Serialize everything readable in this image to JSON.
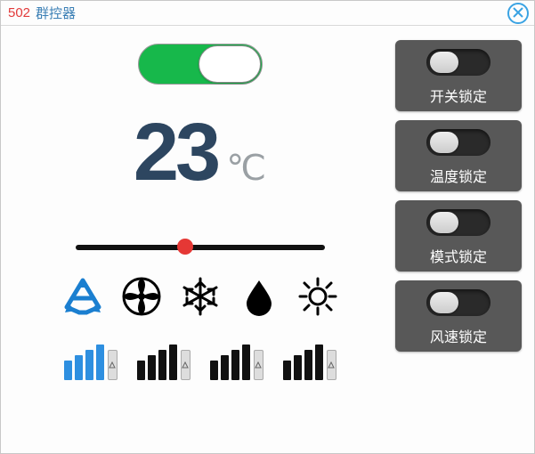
{
  "header": {
    "id": "502",
    "name": "群控器"
  },
  "main": {
    "power_on": true,
    "temperature": "23",
    "temperature_unit": "℃",
    "slider_percent": 44
  },
  "modes": [
    {
      "key": "auto-mode",
      "icon": "recycle-icon",
      "selected": true
    },
    {
      "key": "fan-mode",
      "icon": "fan-icon",
      "selected": false
    },
    {
      "key": "cool-mode",
      "icon": "snowflake-icon",
      "selected": false
    },
    {
      "key": "dry-mode",
      "icon": "droplet-icon",
      "selected": false
    },
    {
      "key": "heat-mode",
      "icon": "sun-icon",
      "selected": false
    }
  ],
  "fan_speeds": [
    {
      "key": "fan-low",
      "selected": true
    },
    {
      "key": "fan-med",
      "selected": false
    },
    {
      "key": "fan-high",
      "selected": false
    },
    {
      "key": "fan-auto",
      "selected": false
    }
  ],
  "locks": [
    {
      "key": "power-lock",
      "label": "开关锁定",
      "on": false
    },
    {
      "key": "temp-lock",
      "label": "温度锁定",
      "on": false
    },
    {
      "key": "mode-lock",
      "label": "模式锁定",
      "on": false
    },
    {
      "key": "fan-lock",
      "label": "风速锁定",
      "on": false
    }
  ],
  "colors": {
    "accent_blue": "#2e8fe0",
    "accent_green": "#17b84b",
    "accent_red": "#e53835",
    "dark_text": "#2d4660"
  }
}
